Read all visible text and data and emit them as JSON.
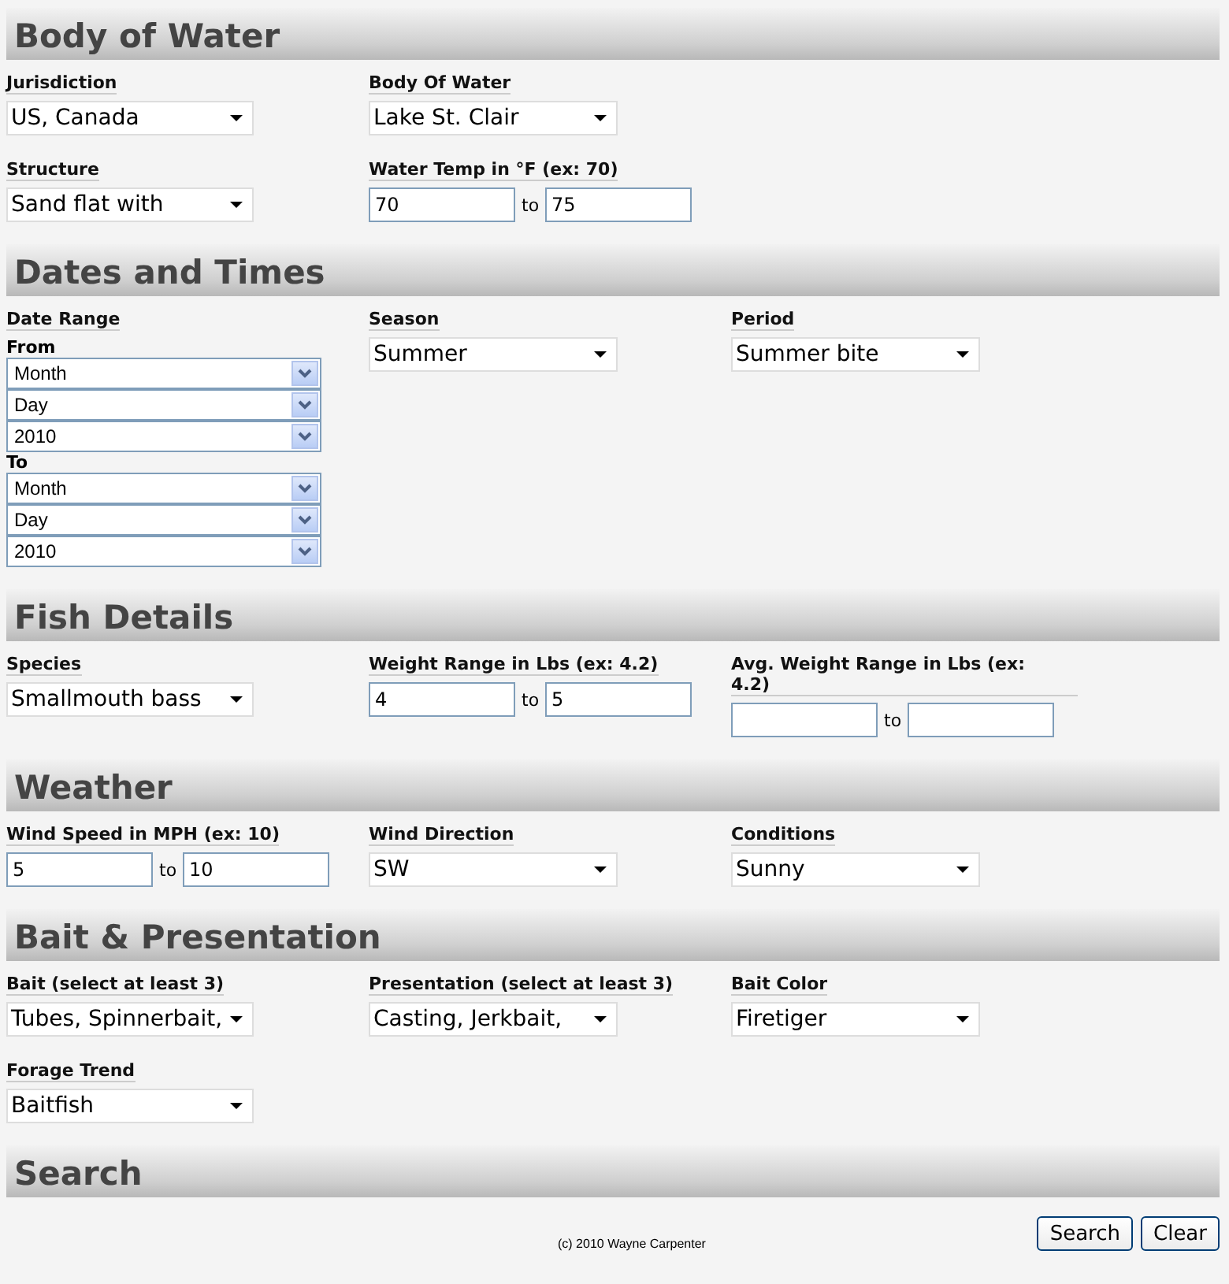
{
  "sections": [
    {
      "title": "Body of Water",
      "rows": [
        [
          {
            "kind": "select",
            "label": "Jurisdiction",
            "value": "US, Canada"
          },
          {
            "kind": "select",
            "label": "Body Of Water",
            "value": "Lake St. Clair"
          }
        ],
        [
          {
            "kind": "select",
            "label": "Structure",
            "value": "Sand flat with"
          },
          {
            "kind": "range",
            "label": "Water Temp in °F (ex: 70)",
            "from": "70",
            "joiner": "to",
            "to": "75"
          }
        ]
      ]
    },
    {
      "title": "Dates and Times",
      "rows": [
        [
          {
            "kind": "daterange",
            "label": "Date Range",
            "parts": [
              {
                "label": "From",
                "selects": [
                  "Month",
                  "Day",
                  "2010"
                ]
              },
              {
                "label": "To",
                "selects": [
                  "Month",
                  "Day",
                  "2010"
                ]
              }
            ]
          },
          {
            "kind": "select",
            "label": "Season",
            "value": "Summer"
          },
          {
            "kind": "select",
            "label": "Period",
            "value": "Summer bite"
          }
        ]
      ]
    },
    {
      "title": "Fish Details",
      "rows": [
        [
          {
            "kind": "select",
            "label": "Species",
            "value": "Smallmouth bass"
          },
          {
            "kind": "range",
            "label": "Weight Range in Lbs (ex: 4.2)",
            "from": "4",
            "joiner": "to",
            "to": "5"
          },
          {
            "kind": "range",
            "label": "Avg. Weight Range in Lbs (ex: 4.2)",
            "joiner": "to"
          }
        ]
      ]
    },
    {
      "title": "Weather",
      "rows": [
        [
          {
            "kind": "range",
            "label": "Wind Speed in MPH (ex: 10)",
            "from": "5",
            "joiner": "to",
            "to": "10"
          },
          {
            "kind": "select",
            "label": "Wind Direction",
            "value": "SW"
          },
          {
            "kind": "select",
            "label": "Conditions",
            "value": "Sunny"
          }
        ]
      ]
    },
    {
      "title": "Bait & Presentation",
      "rows": [
        [
          {
            "kind": "select",
            "label": "Bait (select at least 3)",
            "value": "Tubes, Spinnerbait,"
          },
          {
            "kind": "select",
            "label": "Presentation (select at least 3)",
            "value": "Casting, Jerkbait,"
          },
          {
            "kind": "select",
            "label": "Bait Color",
            "value": "Firetiger"
          }
        ],
        [
          {
            "kind": "select",
            "label": "Forage Trend",
            "value": "Baitfish"
          }
        ]
      ]
    },
    {
      "title": "Search"
    }
  ],
  "footer": {
    "copyright": "(c) 2010 Wayne Carpenter",
    "buttons": [
      "Search",
      "Clear"
    ]
  }
}
